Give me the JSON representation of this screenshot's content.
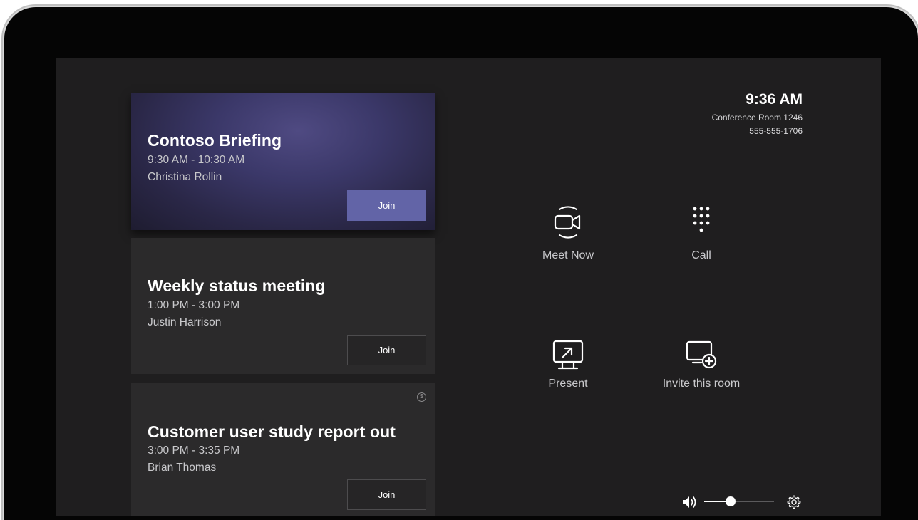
{
  "status": {
    "time": "9:36 AM",
    "room_name": "Conference Room 1246",
    "phone": "555-555-1706"
  },
  "meetings": [
    {
      "title": "Contoso Briefing",
      "time": "9:30 AM - 10:30 AM",
      "organizer": "Christina Rollin",
      "join_label": "Join",
      "active": true
    },
    {
      "title": "Weekly status meeting",
      "time": "1:00 PM - 3:00 PM",
      "organizer": "Justin Harrison",
      "join_label": "Join",
      "active": false
    },
    {
      "title": "Customer user study report out",
      "time": "3:00 PM - 3:35 PM",
      "organizer": "Brian Thomas",
      "join_label": "Join",
      "active": false,
      "badge_icon": "skype-icon",
      "badge_text": "S"
    }
  ],
  "actions": [
    {
      "label": "Meet Now",
      "icon": "video-camera-icon"
    },
    {
      "label": "Call",
      "icon": "dialpad-icon"
    },
    {
      "label": "Present",
      "icon": "present-screen-icon"
    },
    {
      "label": "Invite this room",
      "icon": "invite-room-icon"
    }
  ],
  "volume": {
    "icon": "speaker-icon",
    "level": 0.38
  },
  "settings": {
    "icon": "gear-icon"
  },
  "colors": {
    "accent": "#6264a7",
    "background": "#1f1e1f",
    "card": "#2b2a2b",
    "bezel": "#050505"
  }
}
